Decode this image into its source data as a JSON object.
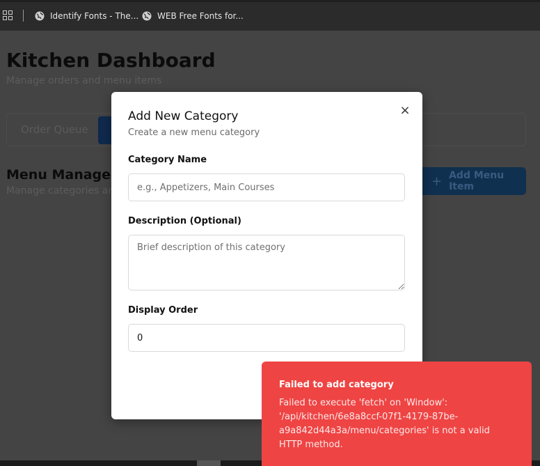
{
  "bookmarks": {
    "items": [
      {
        "label": "Identify Fonts - The..."
      },
      {
        "label": "WEB Free Fonts for..."
      }
    ]
  },
  "page": {
    "title": "Kitchen Dashboard",
    "subtitle": "Manage orders and menu items",
    "tabs": [
      {
        "label": "Order Queue"
      }
    ],
    "section_title": "Menu Managem",
    "section_subtitle": "Manage categories an",
    "add_menu_item_label": "Add Menu Item"
  },
  "modal": {
    "title": "Add New Category",
    "subtitle": "Create a new menu category",
    "close_label": "×",
    "fields": {
      "name_label": "Category Name",
      "name_placeholder": "e.g., Appetizers, Main Courses",
      "description_label": "Description (Optional)",
      "description_placeholder": "Brief description of this category",
      "order_label": "Display Order",
      "order_value": "0"
    }
  },
  "toast": {
    "title": "Failed to add category",
    "message": "Failed to execute 'fetch' on 'Window': '/api/kitchen/6e8a8ccf-07f1-4179-87be-a9a842d44a3a/menu/categories' is not a valid HTTP method.",
    "color": "#ef4444"
  }
}
